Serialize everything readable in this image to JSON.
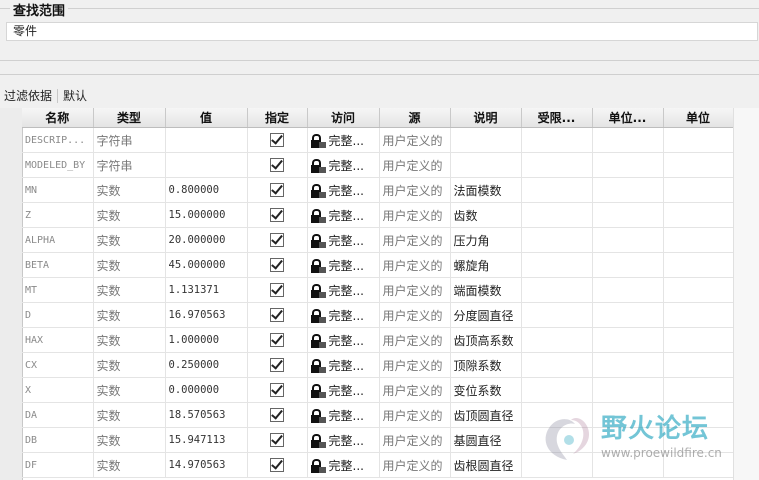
{
  "search_section": {
    "title": "查找范围",
    "scope_value": "零件"
  },
  "filter": {
    "label": "过滤依据",
    "value": "默认"
  },
  "table": {
    "columns": [
      "名称",
      "类型",
      "值",
      "指定",
      "访问",
      "源",
      "说明",
      "受限...",
      "单位...",
      "单位"
    ],
    "rows": [
      {
        "name": "DESCRIP...",
        "type": "字符串",
        "value": "",
        "designated": true,
        "access": "完整...",
        "source": "用户定义的",
        "desc": ""
      },
      {
        "name": "MODELED_BY",
        "type": "字符串",
        "value": "",
        "designated": true,
        "access": "完整...",
        "source": "用户定义的",
        "desc": ""
      },
      {
        "name": "MN",
        "type": "实数",
        "value": "0.800000",
        "designated": true,
        "access": "完整...",
        "source": "用户定义的",
        "desc": "法面模数"
      },
      {
        "name": "Z",
        "type": "实数",
        "value": "15.000000",
        "designated": true,
        "access": "完整...",
        "source": "用户定义的",
        "desc": "齿数"
      },
      {
        "name": "ALPHA",
        "type": "实数",
        "value": "20.000000",
        "designated": true,
        "access": "完整...",
        "source": "用户定义的",
        "desc": "压力角"
      },
      {
        "name": "BETA",
        "type": "实数",
        "value": "45.000000",
        "designated": true,
        "access": "完整...",
        "source": "用户定义的",
        "desc": "螺旋角"
      },
      {
        "name": "MT",
        "type": "实数",
        "value": "1.131371",
        "designated": true,
        "access": "完整...",
        "source": "用户定义的",
        "desc": "端面模数"
      },
      {
        "name": "D",
        "type": "实数",
        "value": "16.970563",
        "designated": true,
        "access": "完整...",
        "source": "用户定义的",
        "desc": "分度圆直径"
      },
      {
        "name": "HAX",
        "type": "实数",
        "value": "1.000000",
        "designated": true,
        "access": "完整...",
        "source": "用户定义的",
        "desc": "齿顶高系数"
      },
      {
        "name": "CX",
        "type": "实数",
        "value": "0.250000",
        "designated": true,
        "access": "完整...",
        "source": "用户定义的",
        "desc": "顶隙系数"
      },
      {
        "name": "X",
        "type": "实数",
        "value": "0.000000",
        "designated": true,
        "access": "完整...",
        "source": "用户定义的",
        "desc": "变位系数"
      },
      {
        "name": "DA",
        "type": "实数",
        "value": "18.570563",
        "designated": true,
        "access": "完整...",
        "source": "用户定义的",
        "desc": "齿顶圆直径"
      },
      {
        "name": "DB",
        "type": "实数",
        "value": "15.947113",
        "designated": true,
        "access": "完整...",
        "source": "用户定义的",
        "desc": "基圆直径"
      },
      {
        "name": "DF",
        "type": "实数",
        "value": "14.970563",
        "designated": true,
        "access": "完整...",
        "source": "用户定义的",
        "desc": "齿根圆直径"
      }
    ]
  },
  "watermark": {
    "title": "野火论坛",
    "url": "www.proewildfire.cn"
  },
  "icons": {
    "lock": "lock-icon",
    "check": "checkbox-checked-icon"
  }
}
